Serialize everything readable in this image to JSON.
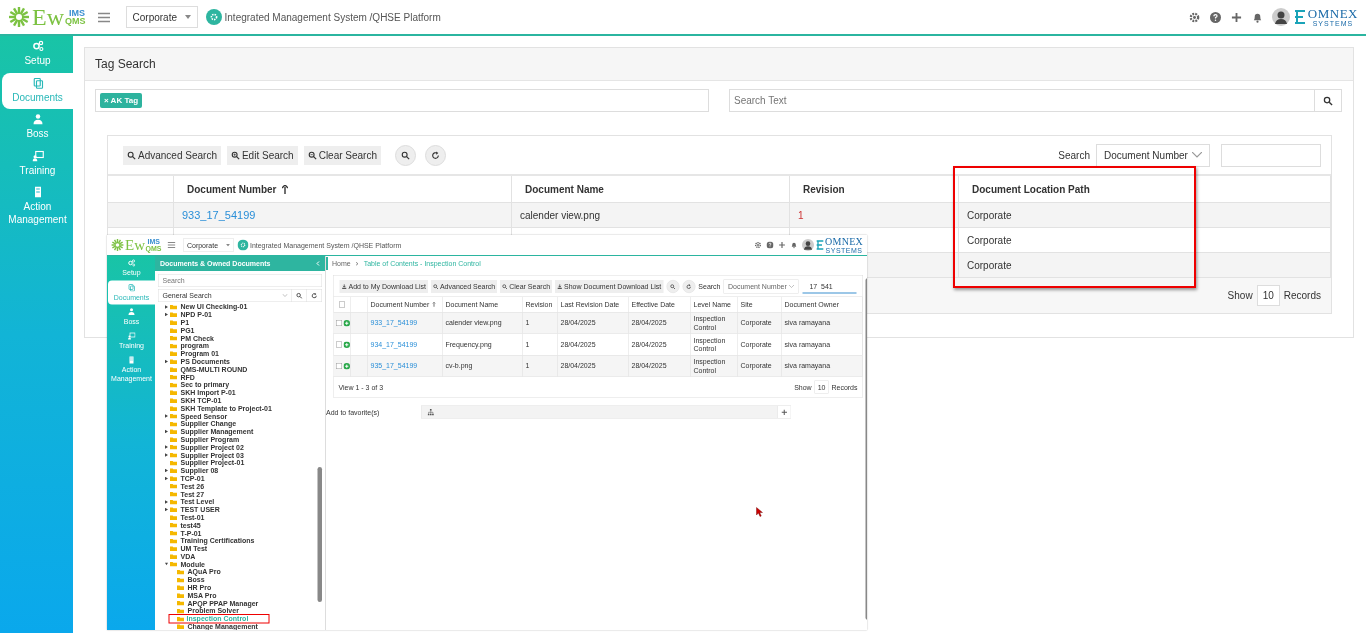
{
  "header": {
    "logo_main": "Ew",
    "logo_top": "IMS",
    "logo_bottom": "QMS",
    "site": "Corporate",
    "title": "Integrated Management System /QHSE Platform",
    "brand": "OMNEX",
    "brand_sub": "SYSTEMS"
  },
  "sidebar": {
    "items": [
      {
        "label": "Setup",
        "kind": "setup",
        "selected": false
      },
      {
        "label": "Documents",
        "kind": "documents",
        "selected": true
      },
      {
        "label": "Boss",
        "kind": "boss",
        "selected": false
      },
      {
        "label": "Training",
        "kind": "training",
        "selected": false
      },
      {
        "label": "Action Management",
        "kind": "action",
        "selected": false
      }
    ]
  },
  "page_title": "Tag Search",
  "tags": [
    {
      "label": "AK Tag",
      "remove": "×"
    }
  ],
  "search_text": {
    "placeholder": "Search Text"
  },
  "toolbar": {
    "buttons": [
      "Advanced Search",
      "Edit Search",
      "Clear Search"
    ],
    "search_label": "Search",
    "search_by": "Document Number"
  },
  "table": {
    "columns": [
      {
        "label": "Document Number",
        "sorted": true,
        "highlighted": false
      },
      {
        "label": "Document Name",
        "sorted": false,
        "highlighted": false
      },
      {
        "label": "Revision",
        "sorted": false,
        "highlighted": false
      },
      {
        "label": "Document Location Path",
        "sorted": false,
        "highlighted": true
      }
    ],
    "rows": [
      {
        "document_number": "933_17_54199",
        "document_name": "calender view.png",
        "revision": "1",
        "location": "Corporate"
      },
      {
        "location": "Corporate"
      },
      {
        "location": "Corporate"
      }
    ],
    "footer": {
      "show": "Show",
      "count": "10",
      "records": "Records"
    }
  },
  "embedded_screenshot": {
    "header": {
      "logo_main": "Ew",
      "logo_top": "IMS",
      "logo_bottom": "QMS",
      "site": "Corporate",
      "title": "Integrated Management System /QHSE Platform",
      "brand": "OMNEX",
      "brand_sub": "SYSTEMS"
    },
    "sidebar": {
      "items": [
        {
          "label": "Setup",
          "kind": "setup",
          "selected": false
        },
        {
          "label": "Documents",
          "kind": "documents",
          "selected": true
        },
        {
          "label": "Boss",
          "kind": "boss",
          "selected": false
        },
        {
          "label": "Training",
          "kind": "training",
          "selected": false
        },
        {
          "label": "Action Management",
          "kind": "action",
          "selected": false
        }
      ]
    },
    "tree_panel": {
      "title": "Documents & Owned Documents",
      "search_placeholder": "Search",
      "search_type": "General Search",
      "items": [
        {
          "label": "New UI Checking-01",
          "has_children": true
        },
        {
          "label": "NPD P-01",
          "has_children": true
        },
        {
          "label": "P1",
          "has_children": false
        },
        {
          "label": "PG1",
          "has_children": false
        },
        {
          "label": "PM Check",
          "has_children": false
        },
        {
          "label": "program",
          "has_children": false
        },
        {
          "label": "Program 01",
          "has_children": false
        },
        {
          "label": "PS Documents",
          "has_children": true
        },
        {
          "label": "QMS-MULTI ROUND",
          "has_children": false
        },
        {
          "label": "RFD",
          "has_children": false
        },
        {
          "label": "Sec to primary",
          "has_children": false
        },
        {
          "label": "SKH Import P-01",
          "has_children": false
        },
        {
          "label": "SKH TCP-01",
          "has_children": false
        },
        {
          "label": "SKH Template to Project-01",
          "has_children": false
        },
        {
          "label": "Speed Sensor",
          "has_children": true
        },
        {
          "label": "Supplier Change",
          "has_children": false
        },
        {
          "label": "Supplier Management",
          "has_children": true
        },
        {
          "label": "Supplier Program",
          "has_children": false
        },
        {
          "label": "Supplier Project 02",
          "has_children": true
        },
        {
          "label": "Supplier Project 03",
          "has_children": true
        },
        {
          "label": "Supplier Project-01",
          "has_children": false
        },
        {
          "label": "Supplier 08",
          "has_children": true
        },
        {
          "label": "TCP-01",
          "has_children": true
        },
        {
          "label": "Test 26",
          "has_children": false
        },
        {
          "label": "Test 27",
          "has_children": false
        },
        {
          "label": "Test Level",
          "has_children": true
        },
        {
          "label": "TEST USER",
          "has_children": true
        },
        {
          "label": "Test-01",
          "has_children": false
        },
        {
          "label": "test45",
          "has_children": false
        },
        {
          "label": "T-P-01",
          "has_children": false
        },
        {
          "label": "Training Certifications",
          "has_children": false
        },
        {
          "label": "UM Test",
          "has_children": false
        },
        {
          "label": "VDA",
          "has_children": false
        },
        {
          "label": "Module",
          "has_children": true,
          "expanded": true,
          "children": [
            {
              "label": "AQuA Pro",
              "selected": false
            },
            {
              "label": "Boss",
              "selected": false
            },
            {
              "label": "HR Pro",
              "selected": false
            },
            {
              "label": "MSA Pro",
              "selected": false
            },
            {
              "label": "APQP PPAP Manager",
              "selected": false
            },
            {
              "label": "Problem Solver",
              "selected": false
            },
            {
              "label": "Inspection Control",
              "selected": true,
              "highlighted": true
            },
            {
              "label": "Change Management",
              "selected": false
            }
          ]
        }
      ]
    },
    "breadcrumb": [
      "Home",
      "Table of Contents - Inspection Control"
    ],
    "toolbar": {
      "buttons": [
        {
          "label": "Add to My Download List",
          "kind": "download"
        },
        {
          "label": "Advanced Search",
          "kind": "search"
        },
        {
          "label": "Clear Search",
          "kind": "search"
        },
        {
          "label": "Show Document Download List",
          "kind": "download"
        }
      ],
      "search_label": "Search",
      "search_by": "Document Number",
      "search_value": "_17_541"
    },
    "table": {
      "all_checked": false,
      "columns": [
        {
          "label": "Document Number",
          "sorted": true
        },
        {
          "label": "Document Name",
          "sorted": false
        },
        {
          "label": "Revision",
          "sorted": false
        },
        {
          "label": "Last Revision Date",
          "sorted": false
        },
        {
          "label": "Effective Date",
          "sorted": false
        },
        {
          "label": "Level Name",
          "sorted": false
        },
        {
          "label": "Site",
          "sorted": false
        },
        {
          "label": "Document Owner",
          "sorted": false
        }
      ],
      "rows": [
        {
          "checked": false,
          "cells": [
            "933_17_54199",
            "calender view.png",
            "1",
            "28/04/2025",
            "28/04/2025",
            "Inspection Control",
            "Corporate",
            "siva ramayana"
          ]
        },
        {
          "checked": false,
          "cells": [
            "934_17_54199",
            "Frequency.png",
            "1",
            "28/04/2025",
            "28/04/2025",
            "Inspection Control",
            "Corporate",
            "siva ramayana"
          ]
        },
        {
          "checked": false,
          "cells": [
            "935_17_54199",
            "cv-b.png",
            "1",
            "28/04/2025",
            "28/04/2025",
            "Inspection Control",
            "Corporate",
            "siva ramayana"
          ]
        }
      ],
      "footer": {
        "view": "View 1 - 3 of 3",
        "show": "Show",
        "count": "10",
        "records": "Records"
      }
    },
    "favorites": {
      "label": "Add to favorite(s)"
    }
  }
}
